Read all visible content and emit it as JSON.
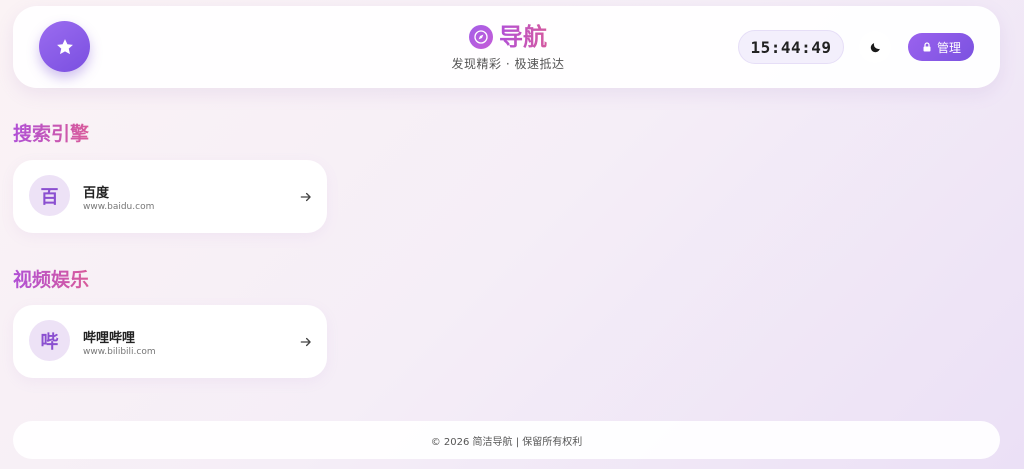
{
  "header": {
    "star_icon": "star-icon",
    "brand_icon": "compass-icon",
    "title": "导航",
    "subtitle": "发现精彩 · 极速抵达",
    "clock": "15:44:49",
    "theme_icon": "moon-icon",
    "admin_label": "管理",
    "admin_icon": "lock-icon"
  },
  "sections": [
    {
      "title": "搜索引擎",
      "links": [
        {
          "avatar": "百",
          "name": "百度",
          "url": "www.baidu.com"
        }
      ]
    },
    {
      "title": "视频娱乐",
      "links": [
        {
          "avatar": "哔",
          "name": "哔哩哔哩",
          "url": "www.bilibili.com"
        }
      ]
    }
  ],
  "footer": {
    "text": "© 2026 简洁导航 | 保留所有权利"
  },
  "colors": {
    "accent": "#8a55e6",
    "title_gradient_start": "#b050d6",
    "title_gradient_end": "#d95b9a",
    "avatar_bg": "#ede2f6"
  }
}
